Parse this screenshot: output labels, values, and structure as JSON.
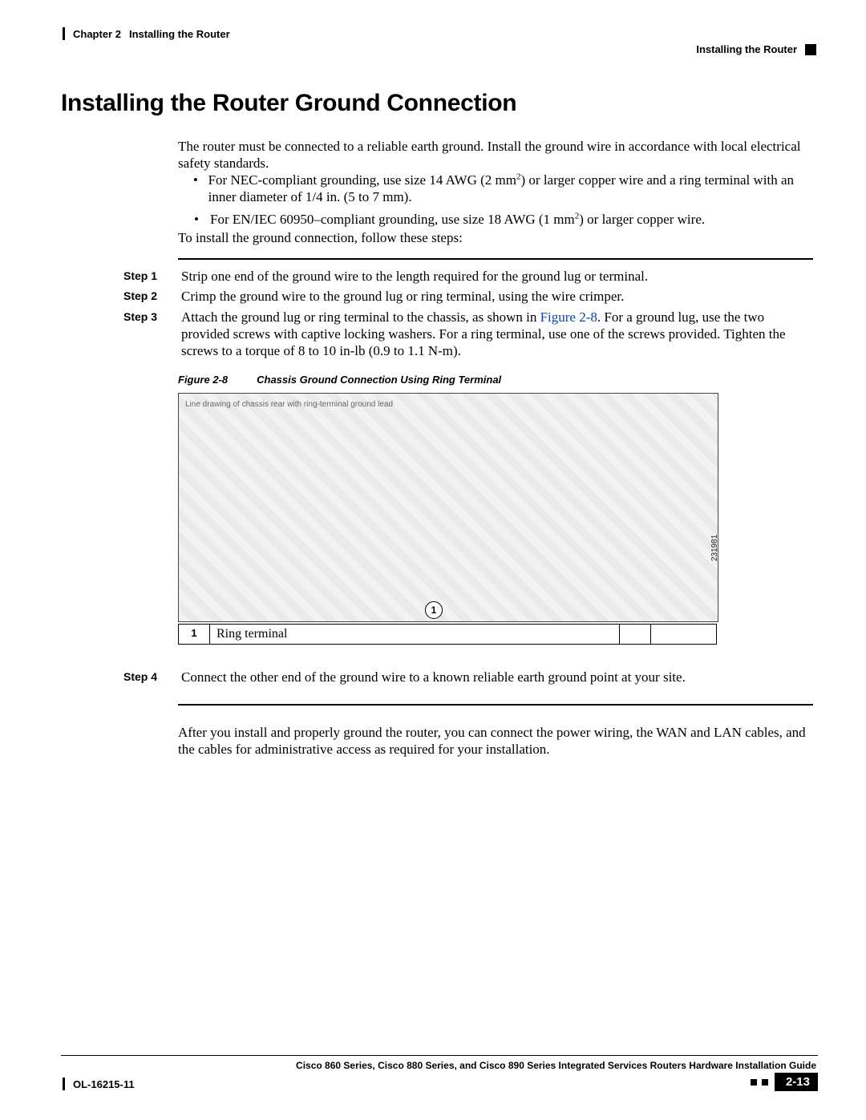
{
  "header": {
    "chapter_label": "Chapter 2",
    "chapter_title": "Installing the Router",
    "section_breadcrumb": "Installing the Router"
  },
  "title": "Installing the Router Ground Connection",
  "intro_para": "The router must be connected to a reliable earth ground. Install the ground wire in accordance with local electrical safety standards.",
  "bullets": [
    {
      "pre": "For NEC-compliant grounding, use size 14 AWG (2 mm",
      "sup": "2",
      "post": ") or larger copper wire and a ring terminal with an inner diameter of 1/4 in. (5 to 7 mm)."
    },
    {
      "pre": "For EN/IEC 60950–compliant grounding, use size 18 AWG (1 mm",
      "sup": "2",
      "post": ") or larger copper wire."
    }
  ],
  "intro_para2": "To install the ground connection, follow these steps:",
  "steps": [
    {
      "label": "Step 1",
      "text": "Strip one end of the ground wire to the length required for the ground lug or terminal."
    },
    {
      "label": "Step 2",
      "text": "Crimp the ground wire to the ground lug or ring terminal, using the wire crimper."
    },
    {
      "label": "Step 3",
      "pre": "Attach the ground lug or ring terminal to the chassis, as shown in ",
      "ref": "Figure 2-8",
      "post": ". For a ground lug, use the two provided screws with captive locking washers. For a ring terminal, use one of the screws provided. Tighten the screws to a torque of 8 to 10 in-lb (0.9 to 1.1 N-m)."
    }
  ],
  "figure": {
    "label": "Figure 2-8",
    "caption": "Chassis Ground Connection Using Ring Terminal",
    "art_number": "231981",
    "callout_number": "1",
    "alt": "Line drawing of chassis rear with ring-terminal ground lead"
  },
  "callout_table": {
    "num": "1",
    "text": "Ring terminal"
  },
  "step4": {
    "label": "Step 4",
    "text": "Connect the other end of the ground wire to a known reliable earth ground point at your site."
  },
  "post_para": "After you install and properly ground the router, you can connect the power wiring, the WAN and LAN cables, and the cables for administrative access as required for your installation.",
  "footer": {
    "book_title": "Cisco 860 Series, Cisco 880 Series, and Cisco 890 Series Integrated Services Routers Hardware Installation Guide",
    "doc_number": "OL-16215-11",
    "page_number": "2-13"
  }
}
